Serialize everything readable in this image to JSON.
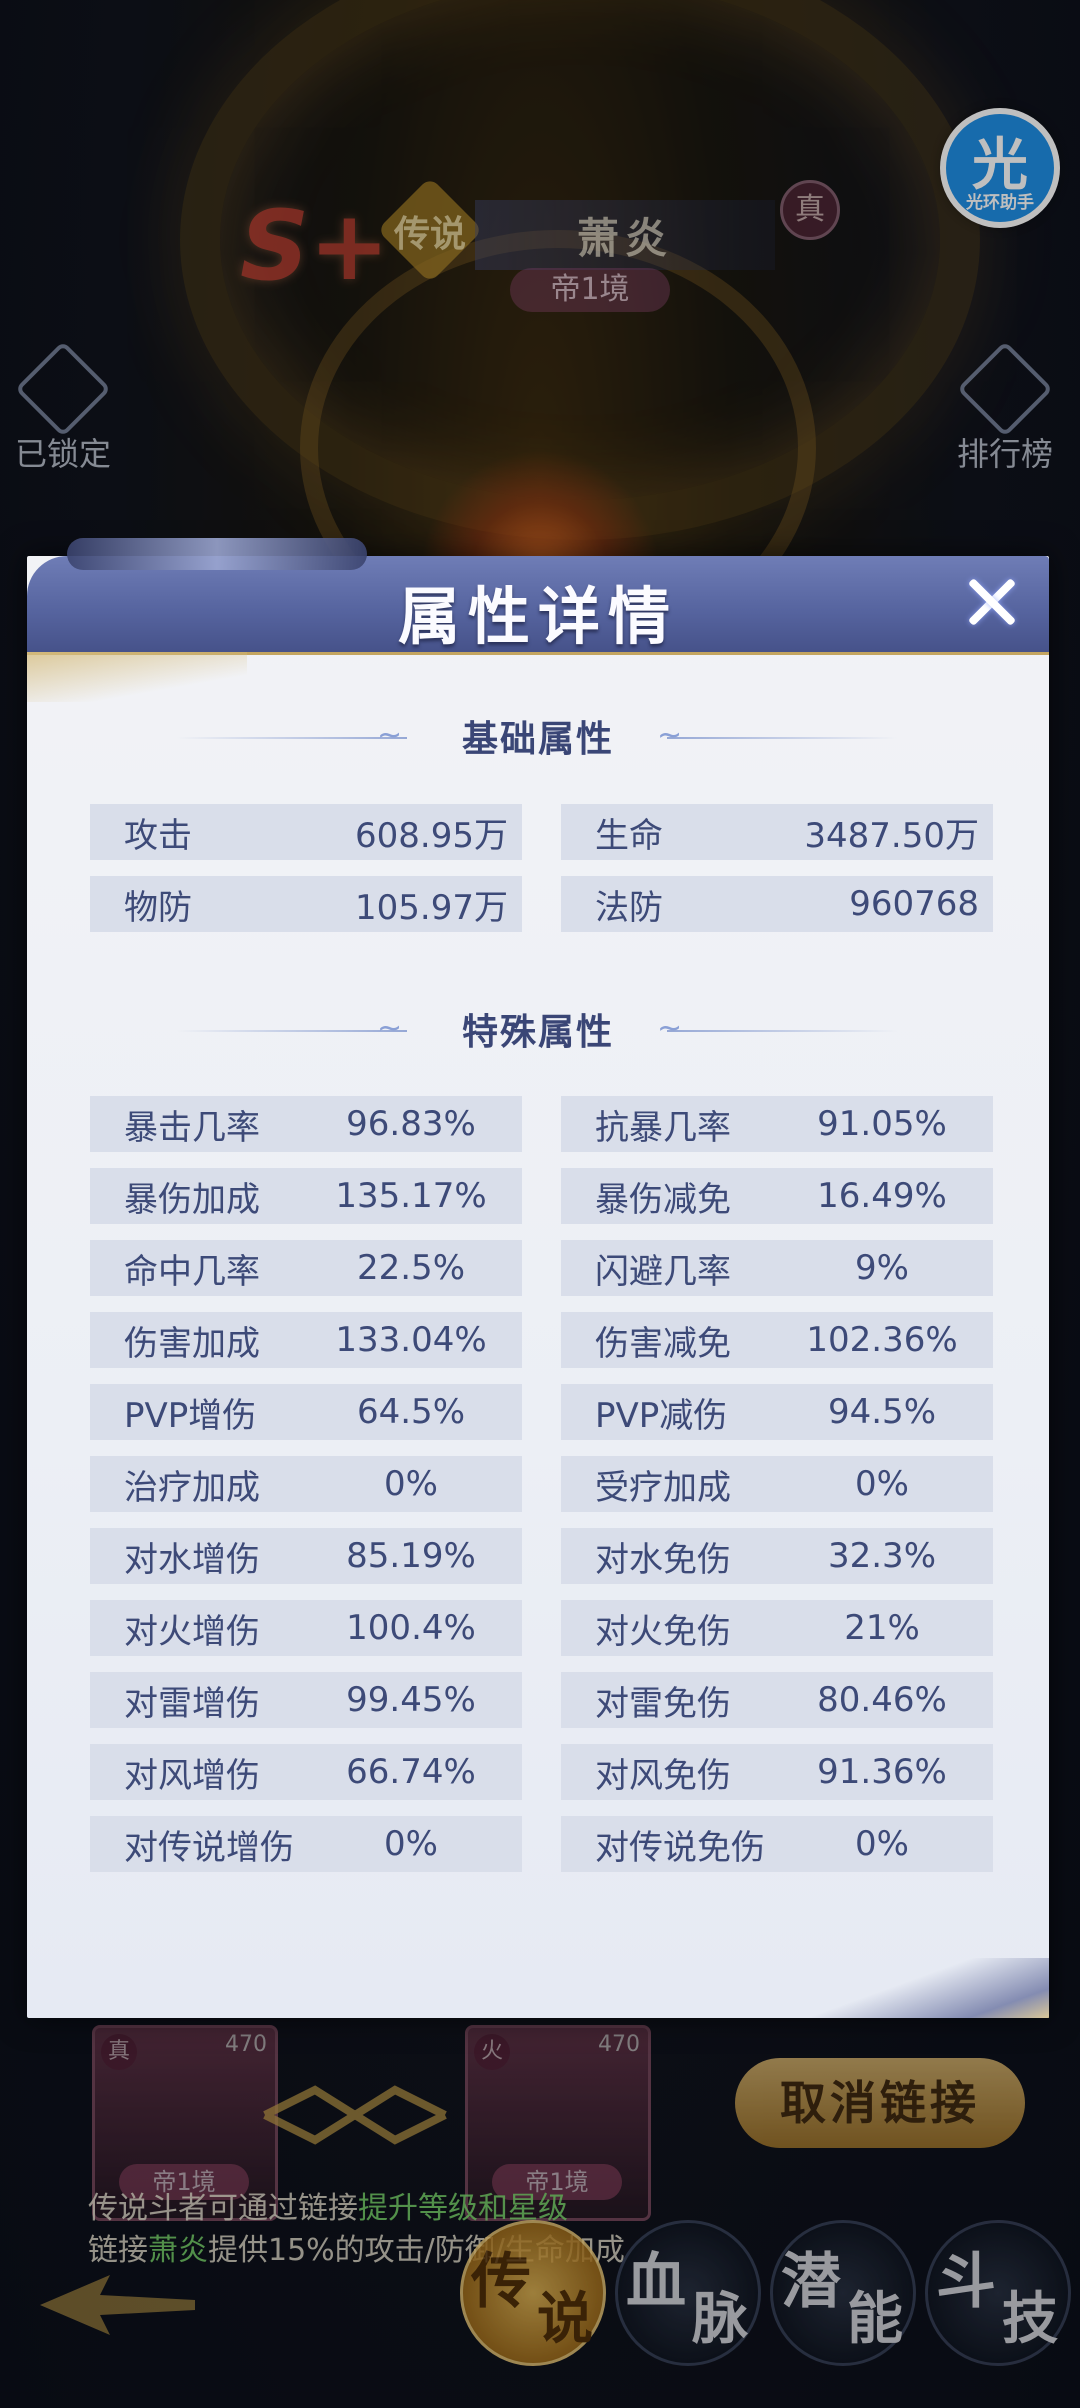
{
  "background": {
    "rank": "S+",
    "legend_badge": "传说",
    "hero_name": "萧炎",
    "true_tag": "真",
    "emperor_rank": "帝1境",
    "locked_label": "已锁定",
    "ranking_label": "排行榜",
    "helper_glyph": "光",
    "helper_label": "光环助手",
    "cards": [
      {
        "tag": "真",
        "level": "470",
        "rank": "帝1境"
      },
      {
        "tag": "火",
        "level": "470",
        "rank": "帝1境"
      }
    ],
    "unlink_button": "取消链接",
    "hint_line1_a": "传说斗者可通过链接",
    "hint_line1_b": "提升等级和星级",
    "hint_line2_a": "链接",
    "hint_line2_b": "萧炎",
    "hint_line2_c": "提供15%的攻击/防御/生命加成",
    "bottom_tabs": [
      {
        "a": "传",
        "b": "说"
      },
      {
        "a": "血",
        "b": "脉"
      },
      {
        "a": "潜",
        "b": "能"
      },
      {
        "a": "斗",
        "b": "技"
      }
    ]
  },
  "modal": {
    "title": "属性详情",
    "basic_title": "基础属性",
    "special_title": "特殊属性",
    "basic": [
      {
        "k": "攻击",
        "v": "608.95万"
      },
      {
        "k": "生命",
        "v": "3487.50万"
      },
      {
        "k": "物防",
        "v": "105.97万"
      },
      {
        "k": "法防",
        "v": "960768"
      }
    ],
    "special": [
      {
        "k": "暴击几率",
        "v": "96.83%"
      },
      {
        "k": "抗暴几率",
        "v": "91.05%"
      },
      {
        "k": "暴伤加成",
        "v": "135.17%"
      },
      {
        "k": "暴伤减免",
        "v": "16.49%"
      },
      {
        "k": "命中几率",
        "v": "22.5%"
      },
      {
        "k": "闪避几率",
        "v": "9%"
      },
      {
        "k": "伤害加成",
        "v": "133.04%"
      },
      {
        "k": "伤害减免",
        "v": "102.36%"
      },
      {
        "k": "PVP增伤",
        "v": "64.5%"
      },
      {
        "k": "PVP减伤",
        "v": "94.5%"
      },
      {
        "k": "治疗加成",
        "v": "0%"
      },
      {
        "k": "受疗加成",
        "v": "0%"
      },
      {
        "k": "对水增伤",
        "v": "85.19%"
      },
      {
        "k": "对水免伤",
        "v": "32.3%"
      },
      {
        "k": "对火增伤",
        "v": "100.4%"
      },
      {
        "k": "对火免伤",
        "v": "21%"
      },
      {
        "k": "对雷增伤",
        "v": "99.45%"
      },
      {
        "k": "对雷免伤",
        "v": "80.46%"
      },
      {
        "k": "对风增伤",
        "v": "66.74%"
      },
      {
        "k": "对风免伤",
        "v": "91.36%"
      },
      {
        "k": "对传说增伤",
        "v": "0%"
      },
      {
        "k": "对传说免伤",
        "v": "0%"
      }
    ]
  }
}
